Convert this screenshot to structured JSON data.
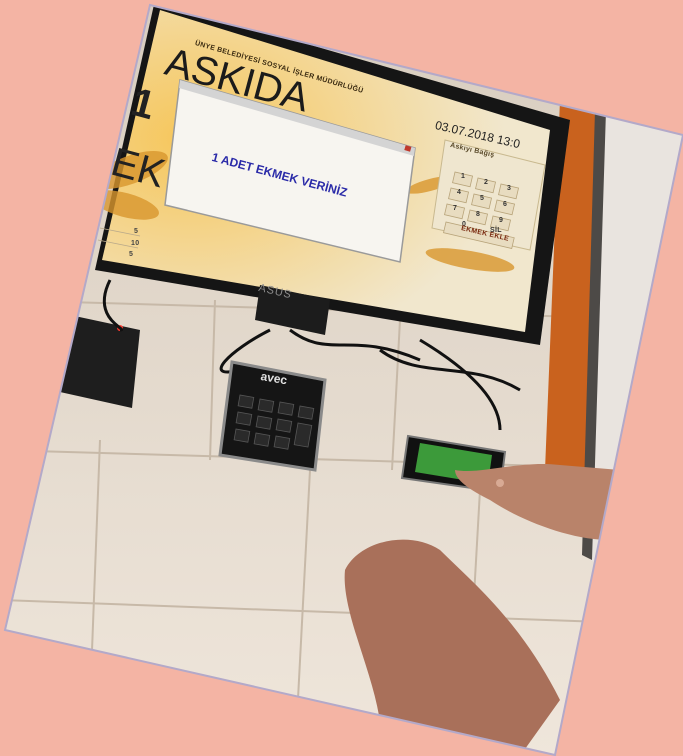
{
  "screen": {
    "header": "ÜNYE BELEDİYESİ SOSYAL İŞLER MÜDÜRLÜĞÜ",
    "app_title": "ASKIDA",
    "side_letters": [
      "1",
      "EK"
    ],
    "datetime": "03.07.2018 13:0",
    "panel_label": "Askıyı Bağış",
    "dialog_message": "1 ADET EKMEK VERİNİZ",
    "keypad_keys": [
      "1",
      "2",
      "3",
      "4",
      "5",
      "6",
      "7",
      "8",
      "9",
      "0",
      "SİL"
    ],
    "action_button": "EKMEK EKLE",
    "left_rows": [
      "5",
      "10",
      "5"
    ]
  },
  "devices": {
    "monitor_brand": "ASUS",
    "numpad_brand": "avec"
  },
  "colors": {
    "background": "#f4b4a4",
    "screen_bg": "#f2ead2",
    "wheat": "#d9962e",
    "dialog_text": "#2a2aa8",
    "phone_screen": "#3c9a3a",
    "wall": "#e8ddd0",
    "door": "#c9621e"
  }
}
